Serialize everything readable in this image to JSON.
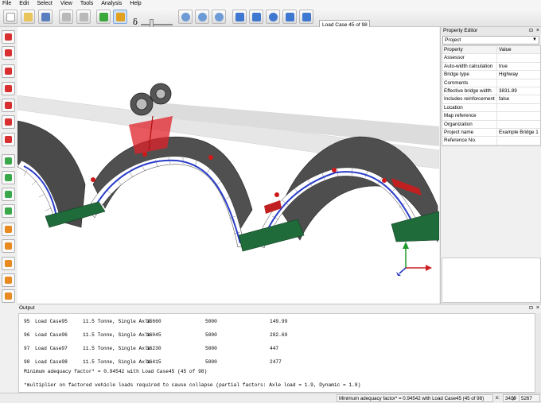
{
  "menu": [
    "File",
    "Edit",
    "Select",
    "View",
    "Tools",
    "Analysis",
    "Help"
  ],
  "toolbar": {
    "delta_symbol": "δ",
    "load_case_selector": "Load Case 45 of 98"
  },
  "property_editor": {
    "title": "Property Editor",
    "object_type": "Project",
    "columns": [
      "Property",
      "Value"
    ],
    "rows": [
      {
        "property": "Assessor",
        "value": ""
      },
      {
        "property": "Auto-width calculation",
        "value": "true"
      },
      {
        "property": "Bridge type",
        "value": "Highway"
      },
      {
        "property": "Comments",
        "value": ""
      },
      {
        "property": "Effective bridge width",
        "value": "3831.89"
      },
      {
        "property": "Includes reinforcement",
        "value": "false"
      },
      {
        "property": "Location",
        "value": ""
      },
      {
        "property": "Map reference",
        "value": ""
      },
      {
        "property": "Organization",
        "value": ""
      },
      {
        "property": "Project name",
        "value": "Example Bridge 1"
      },
      {
        "property": "Reference No.",
        "value": ""
      }
    ]
  },
  "output": {
    "title": "Output",
    "rows": [
      {
        "num": "95",
        "name": "Load Case95",
        "vehicle": "11.5 Tonne, Single Axle",
        "pos": "15660",
        "width": "5000",
        "factor": "149.99"
      },
      {
        "num": "96",
        "name": "Load Case96",
        "vehicle": "11.5 Tonne, Single Axle",
        "pos": "16045",
        "width": "5000",
        "factor": "282.69"
      },
      {
        "num": "97",
        "name": "Load Case97",
        "vehicle": "11.5 Tonne, Single Axle",
        "pos": "16230",
        "width": "5000",
        "factor": "447"
      },
      {
        "num": "98",
        "name": "Load Case98",
        "vehicle": "11.5 Tonne, Single Axle",
        "pos": "16415",
        "width": "5000",
        "factor": "2477"
      }
    ],
    "summary": "Minimum adequacy factor* = 0.94542 with Load Case45 (45 of 98)",
    "footnote": "*multiplier on factored vehicle loads required to cause collapse (partial factors: Axle load = 1.9, Dynamic = 1.8)"
  },
  "statusbar": {
    "message": "Minimum adequacy factor* = 0.94542 with Load Case45 (45 of 98)",
    "x_label": "x:",
    "x_value": "3419",
    "y_label": "y:",
    "y_value": "5267"
  },
  "icons": {
    "left_toolbar": [
      "add-block-icon",
      "add-backfill-icon",
      "add-surcharge-icon",
      "add-pressure-icon",
      "add-support-icon",
      "add-load-icon",
      "add-vehicle-icon",
      "green-block-icon",
      "green-support-icon",
      "green-layer-icon",
      "green-check-icon",
      "orange-material-icon",
      "orange-zone-icon",
      "orange-report-icon",
      "orange-export-icon",
      "orange-print-icon"
    ]
  },
  "colors": {
    "thrust_line": "#2a3dc8",
    "hinge_marker": "#d01818",
    "vehicle_load": "#e0202a",
    "support_base": "#1f6b3a",
    "arch_ring_dark": "#3a3a3a"
  }
}
